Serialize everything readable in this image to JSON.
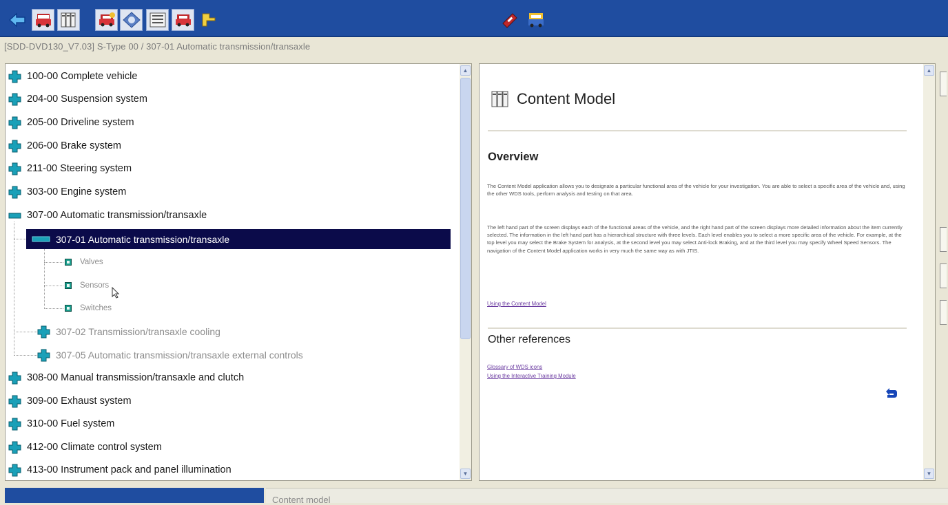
{
  "breadcrumb": "[SDD-DVD130_V7.03]  S-Type 00 / 307-01 Automatic transmission/transaxle",
  "toolbar": {
    "left_icons": [
      "back-arrow-icon",
      "vehicle-icon",
      "content-model-icon",
      "vehicle-diagnostics-icon",
      "disc-icon",
      "list-icon",
      "vehicle-tools-icon",
      "forward-arrow-icon"
    ],
    "right_icons": [
      "toolbox-icon",
      "vehicle-data-icon"
    ]
  },
  "tree": {
    "items": [
      {
        "label": "100-00 Complete vehicle"
      },
      {
        "label": "204-00 Suspension system"
      },
      {
        "label": "205-00 Driveline system"
      },
      {
        "label": "206-00 Brake system"
      },
      {
        "label": "211-00 Steering system"
      },
      {
        "label": "303-00 Engine system"
      },
      {
        "label": "307-00 Automatic transmission/transaxle"
      },
      {
        "label": "307-01 Automatic transmission/transaxle"
      },
      {
        "label": "Valves"
      },
      {
        "label": "Sensors"
      },
      {
        "label": "Switches"
      },
      {
        "label": "307-02 Transmission/transaxle cooling"
      },
      {
        "label": "307-05 Automatic transmission/transaxle external controls"
      },
      {
        "label": "308-00 Manual transmission/transaxle and clutch"
      },
      {
        "label": "309-00 Exhaust system"
      },
      {
        "label": "310-00 Fuel system"
      },
      {
        "label": "412-00 Climate control system"
      },
      {
        "label": "413-00 Instrument pack and panel illumination"
      }
    ]
  },
  "content": {
    "title": "Content Model",
    "overview_heading": "Overview",
    "para1": "The Content Model application allows you to designate a particular functional area of the vehicle for your investigation. You are able to select a specific area of the vehicle and, using the other WDS tools, perform analysis and testing on that area.",
    "para2": "The left hand part of the screen displays each of the functional areas of the vehicle, and the right hand part of the screen displays more detailed information about the item currently selected. The information in the left hand part has a hierarchical structure with three levels. Each level enables you to select a more specific area of the vehicle. For example, at the top level you may select the Brake System for analysis, at the second level you may select Anti-lock Braking, and at the third level you may specify Wheel Speed Sensors. The navigation of the Content Model application works in very much the same way as with JTIS.",
    "link_using": "Using the Content Model",
    "other_heading": "Other references",
    "link_glossary": "Glossary of WDS icons",
    "link_training": "Using the Interactive Training Module"
  },
  "status": {
    "text": "Content model"
  },
  "colors": {
    "toolbar": "#1f4da0",
    "selection": "#0b0b4a",
    "plus_icon": "#1aa0b8"
  }
}
